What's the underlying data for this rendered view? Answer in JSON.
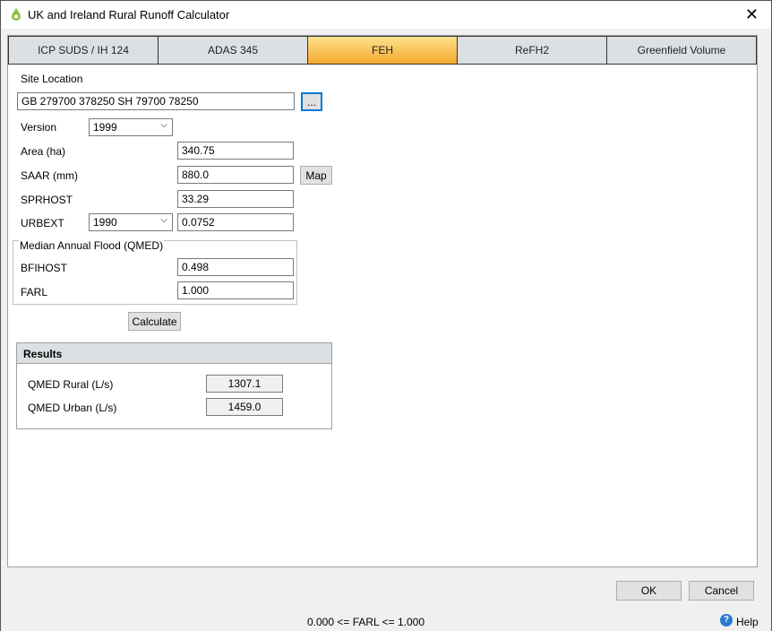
{
  "window": {
    "title": "UK and Ireland Rural Runoff Calculator",
    "close": "✕"
  },
  "tabs": [
    "ICP SUDS / IH 124",
    "ADAS 345",
    "FEH",
    "ReFH2",
    "Greenfield Volume"
  ],
  "site": {
    "label": "Site Location",
    "value": "GB 279700 378250 SH 79700 78250",
    "browse": "..."
  },
  "version": {
    "label": "Version",
    "value": "1999"
  },
  "area": {
    "label": "Area (ha)",
    "value": "340.75"
  },
  "saar": {
    "label": "SAAR (mm)",
    "value": "880.0",
    "map": "Map"
  },
  "sprhost": {
    "label": "SPRHOST",
    "value": "33.29"
  },
  "urbext": {
    "label": "URBEXT",
    "year": "1990",
    "value": "0.0752"
  },
  "qmed_group": {
    "label": "Median Annual Flood (QMED)",
    "bfihost_label": "BFIHOST",
    "bfihost": "0.498",
    "farl_label": "FARL",
    "farl": "1.000"
  },
  "calculate": "Calculate",
  "results": {
    "title": "Results",
    "rural_label": "QMED Rural (L/s)",
    "rural": "1307.1",
    "urban_label": "QMED Urban (L/s)",
    "urban": "1459.0"
  },
  "buttons": {
    "ok": "OK",
    "cancel": "Cancel"
  },
  "status": {
    "message": "0.000 <= FARL <= 1.000",
    "help": "Help"
  }
}
